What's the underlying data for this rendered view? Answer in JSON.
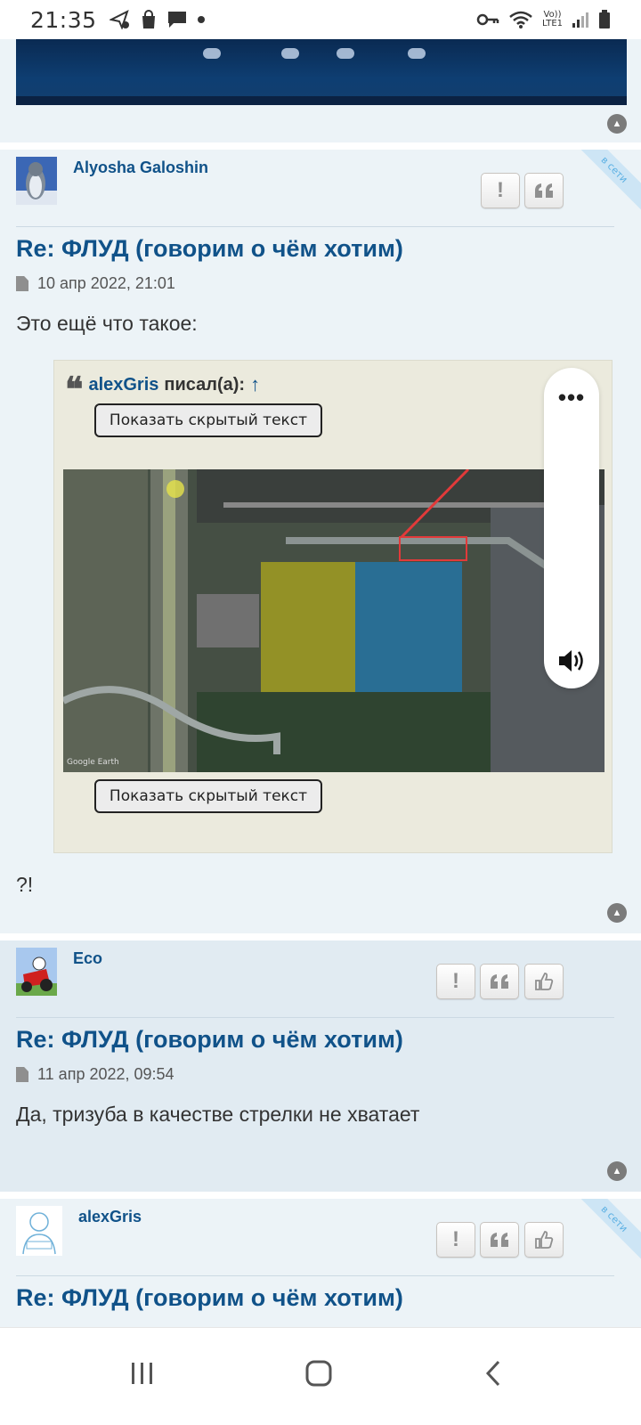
{
  "status_bar": {
    "time": "21:35",
    "left_icons": [
      "navigation-check-icon",
      "shopping-bag-icon",
      "chat-bubble-icon",
      "dot-icon"
    ],
    "network_label_top": "Vo))",
    "network_label_bottom": "LTE1",
    "right_icons": [
      "key-icon",
      "wifi-icon",
      "signal-icon",
      "battery-icon"
    ]
  },
  "posts": [
    {
      "author": "Alyosha Galoshin",
      "online_label": "в сети",
      "title": "Re: ФЛУД (говорим о чём хотим)",
      "date": "10 апр 2022, 21:01",
      "text_before": "Это ещё что такое:",
      "quote": {
        "author": "alexGris",
        "wrote": "писал(а):",
        "arrow": "↑",
        "spoiler_label_1": "Показать скрытый текст",
        "spoiler_label_2": "Показать скрытый текст",
        "image_credit": "Google Earth"
      },
      "text_after": "?!"
    },
    {
      "author": "Eco",
      "title": "Re: ФЛУД (говорим о чём хотим)",
      "date": "11 апр 2022, 09:54",
      "text": "Да, тризуба в качестве стрелки не хватает"
    },
    {
      "author": "alexGris",
      "online_label": "в сети",
      "title": "Re: ФЛУД (говорим о чём хотим)"
    }
  ],
  "buttons": {
    "report": "!",
    "quote": "❝",
    "like": "👍"
  },
  "overlay": {
    "more_label": "•••"
  },
  "colors": {
    "link": "#105289",
    "post_light": "#ecf3f7",
    "post_dark": "#e1ebf2",
    "quote_bg": "#ebeadd"
  }
}
